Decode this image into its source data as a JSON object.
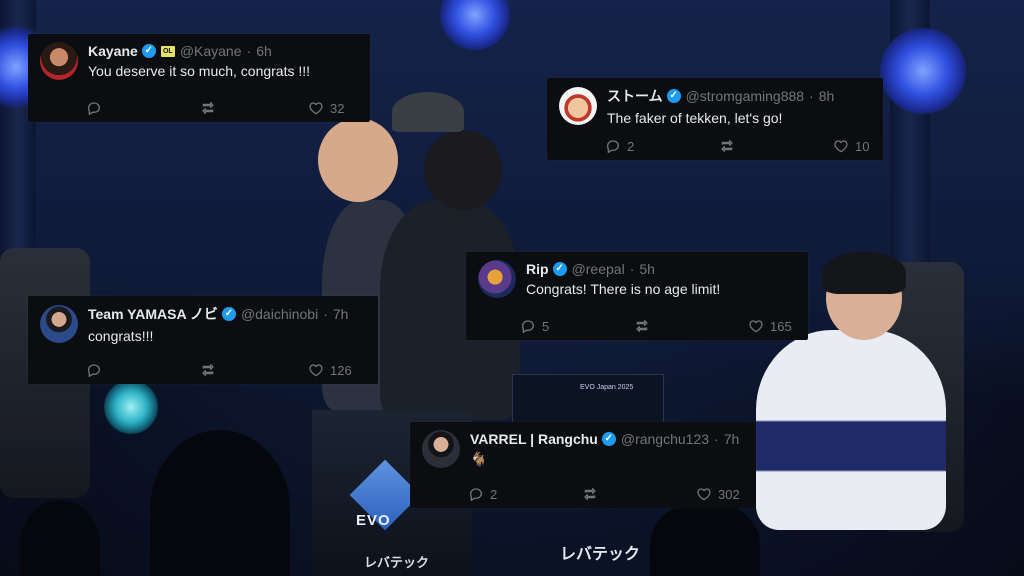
{
  "scene": {
    "podium_brand": "EVO",
    "podium_sub": "レバテック",
    "monitor_text": "EVO Japan 2025",
    "banner_text": "レバテック"
  },
  "tweets": [
    {
      "name": "Kayane",
      "verified": true,
      "affiliate_badge": "OL",
      "handle": "@Kayane",
      "time": "6h",
      "text": "You deserve it so much, congrats !!!",
      "reply_count": "",
      "retweet_count": "",
      "like_count": "32"
    },
    {
      "name": "ストーム",
      "verified": true,
      "handle": "@stromgaming888",
      "time": "8h",
      "text": "The faker of tekken, let's go!",
      "reply_count": "2",
      "retweet_count": "",
      "like_count": "10"
    },
    {
      "name": "Rip",
      "verified": true,
      "handle": "@reepal",
      "time": "5h",
      "text": "Congrats! There is no age limit!",
      "reply_count": "5",
      "retweet_count": "",
      "like_count": "165"
    },
    {
      "name": "Team YAMASA ノビ",
      "verified": true,
      "handle": "@daichinobi",
      "time": "7h",
      "text": "congrats!!!",
      "reply_count": "",
      "retweet_count": "",
      "like_count": "126"
    },
    {
      "name": "VARREL | Rangchu",
      "verified": true,
      "handle": "@rangchu123",
      "time": "7h",
      "text": "🐐",
      "reply_count": "2",
      "retweet_count": "",
      "like_count": "302"
    }
  ],
  "colors": {
    "card_bg": "#0b0d10",
    "verified": "#1d9bf0",
    "muted": "#71767b",
    "text": "#e7e9ea"
  },
  "icons": [
    "reply-icon",
    "retweet-icon",
    "like-icon",
    "verified-icon"
  ]
}
